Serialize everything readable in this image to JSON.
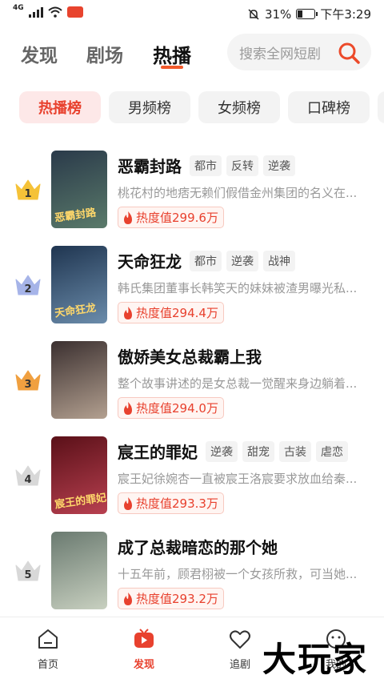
{
  "status_bar": {
    "network": "4G",
    "battery_percent": "31%",
    "battery_level": 0.31,
    "time": "下午3:29"
  },
  "top_nav": {
    "tabs": [
      {
        "label": "发现"
      },
      {
        "label": "剧场"
      },
      {
        "label": "热播"
      }
    ],
    "active_tab": "热播",
    "search_placeholder": "搜索全网短剧"
  },
  "chips": [
    {
      "label": "热播榜"
    },
    {
      "label": "男频榜"
    },
    {
      "label": "女频榜"
    },
    {
      "label": "口碑榜"
    }
  ],
  "list": [
    {
      "rank": "1",
      "title": "恶霸封路",
      "tags": [
        "都市",
        "反转",
        "逆袭"
      ],
      "desc": "桃花村的地痞无赖们假借金州集团的名义在...",
      "heat": "热度值299.6万",
      "poster_text": "恶霸封路",
      "poster_colors": [
        "#2a3a4a",
        "#5a7a6a"
      ]
    },
    {
      "rank": "2",
      "title": "天命狂龙",
      "tags": [
        "都市",
        "逆袭",
        "战神"
      ],
      "desc": "韩氏集团董事长韩笑天的妹妹被渣男曝光私...",
      "heat": "热度值294.4万",
      "poster_text": "天命狂龙",
      "poster_colors": [
        "#1f3550",
        "#6b8cab"
      ]
    },
    {
      "rank": "3",
      "title": "傲娇美女总裁霸上我",
      "tags": [],
      "desc": "整个故事讲述的是女总裁一觉醒来身边躺着...",
      "heat": "热度值294.0万",
      "poster_text": "",
      "poster_colors": [
        "#3b3030",
        "#b3a090"
      ]
    },
    {
      "rank": "4",
      "title": "宸王的罪妃",
      "tags": [
        "逆袭",
        "甜宠",
        "古装",
        "虐恋"
      ],
      "desc": "宸王妃徐婉杏一直被宸王洛宸要求放血给秦...",
      "heat": "热度值293.3万",
      "poster_text": "宸王的罪妃",
      "poster_colors": [
        "#5a1018",
        "#b84050"
      ]
    },
    {
      "rank": "5",
      "title": "成了总裁暗恋的那个她",
      "tags": [],
      "desc": "十五年前，顾君栩被一个女孩所救，可当她...",
      "heat": "热度值293.2万",
      "poster_text": "",
      "poster_colors": [
        "#6a7a70",
        "#c8d0c0"
      ]
    }
  ],
  "bottom_nav": [
    {
      "label": "首页",
      "icon": "home-icon"
    },
    {
      "label": "发现",
      "icon": "play-tv-icon"
    },
    {
      "label": "追剧",
      "icon": "heart-icon"
    },
    {
      "label": "我的",
      "icon": "profile-icon"
    }
  ],
  "active_bottom": "发现",
  "watermark": "大玩家",
  "colors": {
    "accent": "#e8412e",
    "gold_crown": "#f5c238",
    "silver_crown": "#a6b4e8",
    "bronze_crown": "#f0a040",
    "grey_crown": "#d8d8d8"
  }
}
